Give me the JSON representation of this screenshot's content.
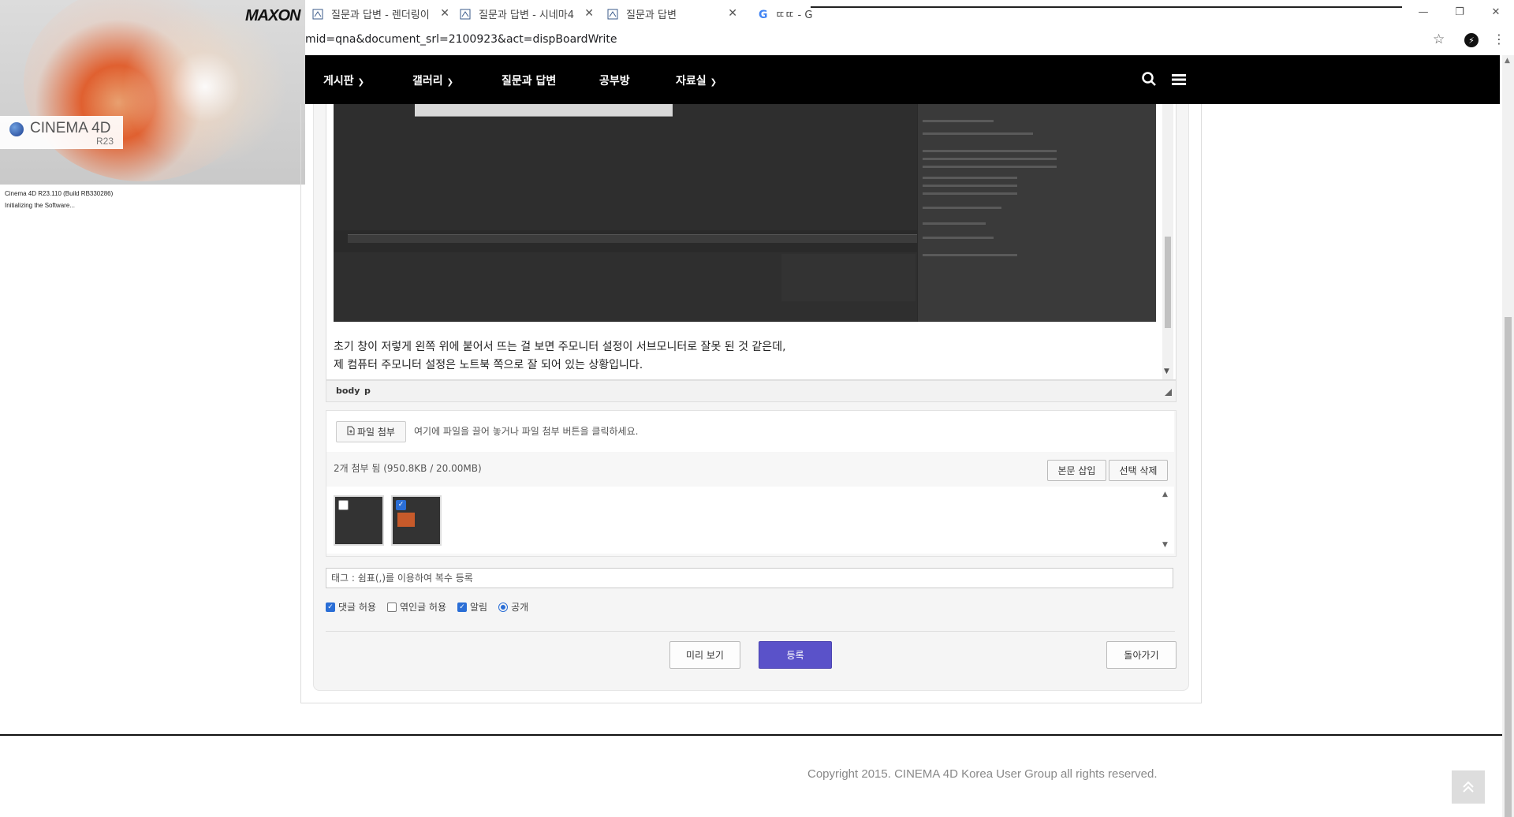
{
  "browser": {
    "tabs": [
      {
        "label": "질문과 답변 - 렌더링이"
      },
      {
        "label": "질문과 답변 - 시네마4"
      },
      {
        "label": "질문과 답변"
      },
      {
        "label": "ㄸㄸ - G"
      }
    ],
    "url": "mid=qna&document_srl=2100923&act=dispBoardWrite",
    "window_controls": [
      "—",
      "❐",
      "✕"
    ]
  },
  "splash": {
    "brand": "MAXON",
    "product": "CINEMA 4D",
    "version": "R23",
    "status_line1": "Cinema 4D R23.110 (Build RB330286)",
    "status_line2": "Initializing the Software..."
  },
  "nav": {
    "items": [
      {
        "label": "게시판",
        "has_dropdown": true
      },
      {
        "label": "갤러리",
        "has_dropdown": true
      },
      {
        "label": "질문과 답변",
        "has_dropdown": false
      },
      {
        "label": "공부방",
        "has_dropdown": false
      },
      {
        "label": "자료실",
        "has_dropdown": true
      }
    ]
  },
  "editor": {
    "line1": "초기 창이 저렇게 왼쪽 위에 붙어서 뜨는 걸 보면 주모니터 설정이 서브모니터로 잘못 된 것 같은데,",
    "line2": "제 컴퓨터 주모니터 설정은 노트북 쪽으로 잘 되어 있는 상황입니다.",
    "path_body": "body",
    "path_p": "p"
  },
  "attach": {
    "file_button": "파일 첨부",
    "drop_hint": "여기에 파일을 끌어 놓거나 파일 첨부 버튼을 클릭하세요.",
    "count_text": "2개 첨부 됨 (950.8KB / 20.00MB)",
    "insert_button": "본문 삽입",
    "delete_button": "선택 삭제",
    "thumbnails": [
      {
        "checked": false
      },
      {
        "checked": true
      }
    ]
  },
  "tag": {
    "placeholder": "태그 : 쉼표(,)를 이용하여 복수 등록"
  },
  "options": {
    "allow_comment": {
      "label": "댓글 허용",
      "checked": true
    },
    "allow_trackback": {
      "label": "엮인글 허용",
      "checked": false
    },
    "notify": {
      "label": "알림",
      "checked": true
    },
    "public": {
      "label": "공개",
      "selected": true
    }
  },
  "actions": {
    "preview": "미리 보기",
    "submit": "등록",
    "back": "돌아가기"
  },
  "footer": {
    "copyright": "Copyright 2015. CINEMA 4D Korea User Group all rights reserved."
  },
  "colors": {
    "submit": "#5a52c9",
    "nav_bg": "#000000",
    "checkbox": "#2a6ed6"
  }
}
